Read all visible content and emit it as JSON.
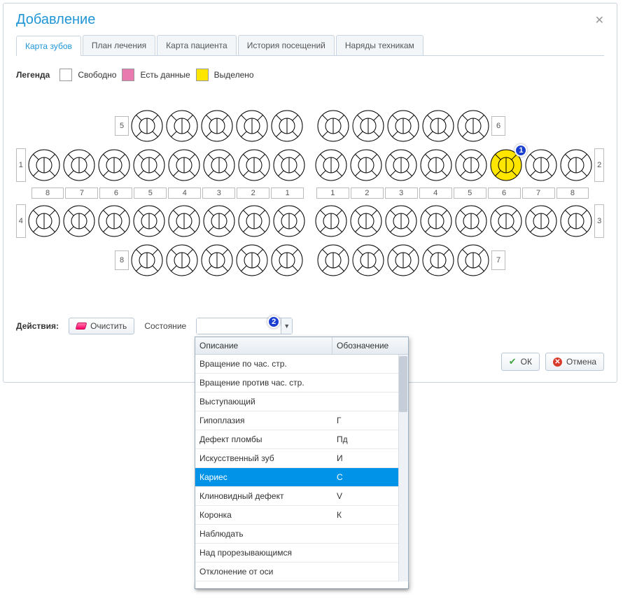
{
  "dialog": {
    "title": "Добавление"
  },
  "tabs": [
    {
      "label": "Карта зубов",
      "active": true
    },
    {
      "label": "План лечения",
      "active": false
    },
    {
      "label": "Карта пациента",
      "active": false
    },
    {
      "label": "История посещений",
      "active": false
    },
    {
      "label": "Наряды техникам",
      "active": false
    }
  ],
  "legend": {
    "title": "Легенда",
    "free": "Свободно",
    "has_data": "Есть данные",
    "selected": "Выделено"
  },
  "chart": {
    "row_deciduous_upper": {
      "left_label": "5",
      "right_label": "6",
      "count_each_side": 5
    },
    "row_perm_upper": {
      "left_label": "1",
      "right_label": "2",
      "count_each_side": 8,
      "selected_right_index": 5
    },
    "number_row": {
      "left": [
        "8",
        "7",
        "6",
        "5",
        "4",
        "3",
        "2",
        "1"
      ],
      "right": [
        "1",
        "2",
        "3",
        "4",
        "5",
        "6",
        "7",
        "8"
      ]
    },
    "row_perm_lower": {
      "left_label": "4",
      "right_label": "3",
      "count_each_side": 8
    },
    "row_deciduous_lower": {
      "left_label": "8",
      "right_label": "7",
      "count_each_side": 5
    },
    "callouts": {
      "selected_tooth": "1",
      "combo": "2"
    }
  },
  "actions": {
    "label": "Действия:",
    "clear_btn": "Очистить",
    "state_label": "Состояние",
    "combo_value": ""
  },
  "dropdown": {
    "cols": {
      "c1": "Описание",
      "c2": "Обозначение"
    },
    "rows": [
      {
        "desc": "Вращение по час. стр.",
        "code": ""
      },
      {
        "desc": "Вращение против час. стр.",
        "code": ""
      },
      {
        "desc": "Выступающий",
        "code": ""
      },
      {
        "desc": "Гипоплазия",
        "code": "Г"
      },
      {
        "desc": "Дефект пломбы",
        "code": "Пд"
      },
      {
        "desc": "Искусственный зуб",
        "code": "И"
      },
      {
        "desc": "Кариес",
        "code": "С",
        "selected": true
      },
      {
        "desc": "Клиновидный дефект",
        "code": "V"
      },
      {
        "desc": "Коронка",
        "code": "К"
      },
      {
        "desc": "Наблюдать",
        "code": ""
      },
      {
        "desc": "Над прорезывающимся",
        "code": ""
      },
      {
        "desc": "Отклонение от оси",
        "code": ""
      }
    ]
  },
  "footer": {
    "ok": "ОК",
    "cancel": "Отмена"
  }
}
